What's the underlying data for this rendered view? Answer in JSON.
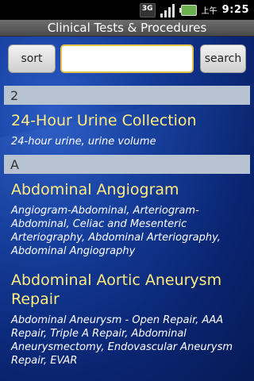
{
  "statusbar": {
    "network": "3G",
    "ampm": "上午",
    "time": "9:25"
  },
  "titlebar": {
    "title": "Clinical Tests & Procedures"
  },
  "toolbar": {
    "sort_label": "sort",
    "search_label": "search",
    "search_value": ""
  },
  "list": [
    {
      "header": "2",
      "items": [
        {
          "title": "24-Hour Urine Collection",
          "subtitle": "24-hour urine, urine volume"
        }
      ]
    },
    {
      "header": "A",
      "items": [
        {
          "title": "Abdominal Angiogram",
          "subtitle": "Angiogram-Abdominal, Arteriogram-Abdominal, Celiac and Mesenteric Arteriography, Abdominal Arteriography, Abdominal Angiography"
        },
        {
          "title": "Abdominal Aortic Aneurysm Repair",
          "subtitle": "Abdominal Aneurysm - Open Repair, AAA Repair, Triple A Repair, Abdominal Aneurysmectomy, Endovascular Aneurysm Repair, EVAR"
        }
      ]
    }
  ]
}
